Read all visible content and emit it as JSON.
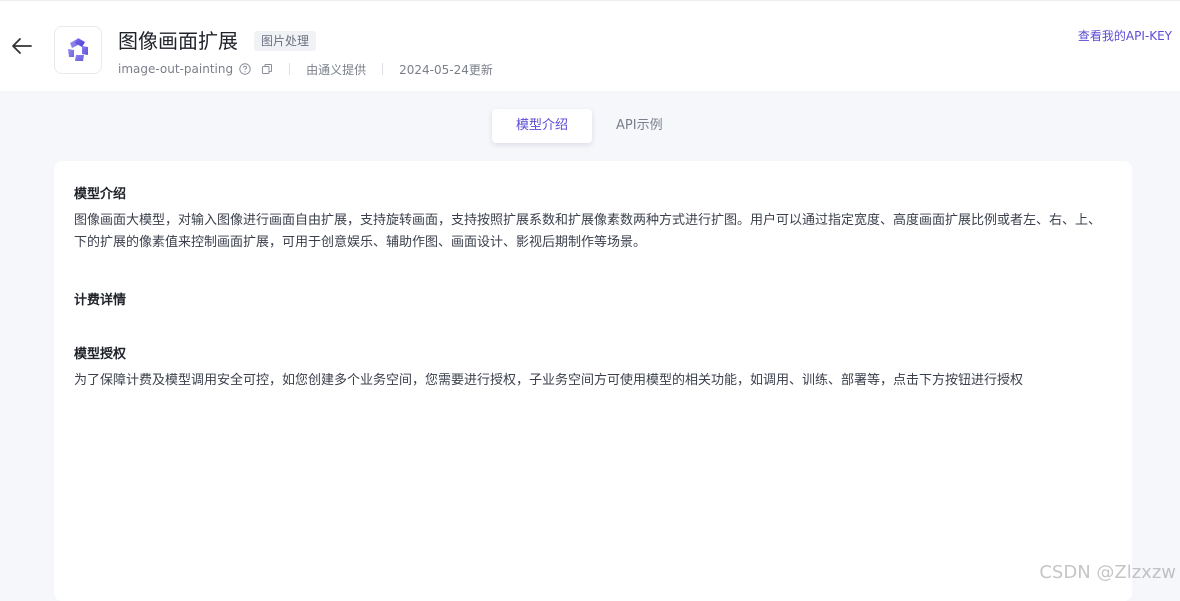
{
  "header": {
    "title": "图像画面扩展",
    "tag": "图片处理",
    "model_id": "image-out-painting",
    "provider": "由通义提供",
    "updated": "2024-05-24更新",
    "api_key_link": "查看我的API-KEY"
  },
  "tabs": [
    {
      "label": "模型介绍",
      "active": true
    },
    {
      "label": "API示例",
      "active": false
    }
  ],
  "content": {
    "intro_title": "模型介绍",
    "intro_text": "图像画面大模型，对输入图像进行画面自由扩展，支持旋转画面，支持按照扩展系数和扩展像素数两种方式进行扩图。用户可以通过指定宽度、高度画面扩展比例或者左、右、上、下的扩展的像素值来控制画面扩展，可用于创意娱乐、辅助作图、画面设计、影视后期制作等场景。",
    "billing_title": "计费详情",
    "auth_title": "模型授权",
    "auth_text": "为了保障计费及模型调用安全可控，如您创建多个业务空间，您需要进行授权，子业务空间方可使用模型的相关功能，如调用、训练、部署等，点击下方按钮进行授权"
  },
  "watermark": "CSDN @Zlzxzw",
  "colors": {
    "accent": "#5b4bd6",
    "background": "#f6f7fb"
  }
}
